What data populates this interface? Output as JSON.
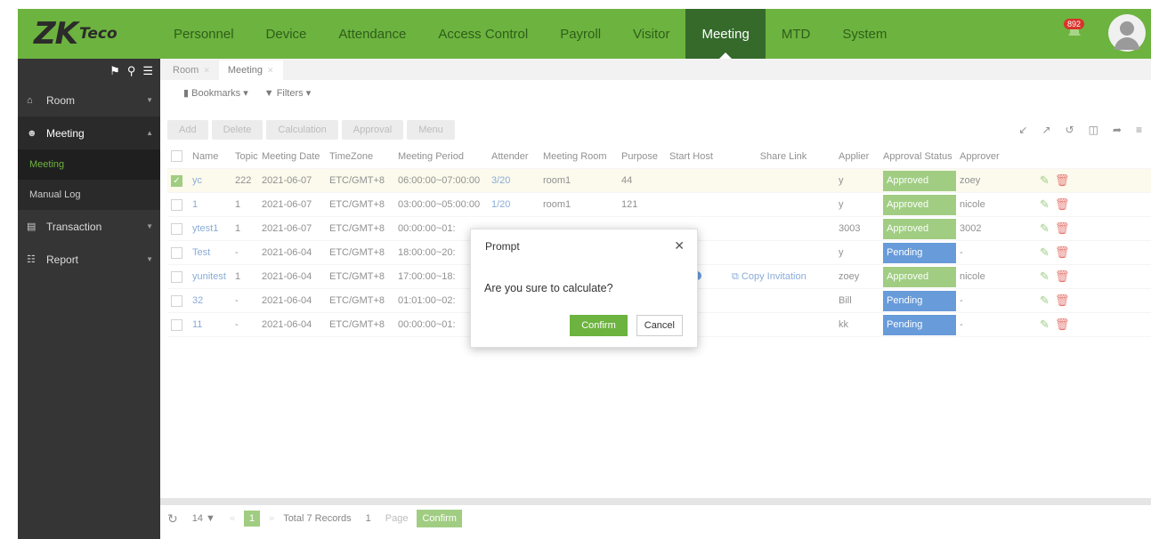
{
  "brand": {
    "logo_main": "ZK",
    "logo_sub": "Teco"
  },
  "nav": [
    "Personnel",
    "Device",
    "Attendance",
    "Access Control",
    "Payroll",
    "Visitor",
    "Meeting",
    "MTD",
    "System"
  ],
  "nav_active": "Meeting",
  "notifications": {
    "count": "892"
  },
  "sidebar": {
    "items": [
      {
        "label": "Room",
        "icon": "house-icon"
      },
      {
        "label": "Meeting",
        "icon": "people-icon"
      },
      {
        "label": "Transaction",
        "icon": "database-icon"
      },
      {
        "label": "Report",
        "icon": "report-icon"
      }
    ],
    "sub_items": [
      "Meeting",
      "Manual Log"
    ]
  },
  "tabs": [
    "Room",
    "Meeting"
  ],
  "filters": {
    "bookmarks": "Bookmarks",
    "filters": "Filters"
  },
  "toolbar": {
    "add": "Add",
    "delete": "Delete",
    "calculation": "Calculation",
    "approval": "Approval",
    "menu": "Menu"
  },
  "table": {
    "headers": [
      "Name",
      "Topic",
      "Meeting Date",
      "TimeZone",
      "Meeting Period",
      "Attender",
      "Meeting Room",
      "Purpose",
      "Start Host",
      "Share Link",
      "Applier",
      "Approval Status",
      "Approver"
    ],
    "rows": [
      {
        "name": "yc",
        "topic": "222",
        "date": "2021-06-07",
        "tz": "ETC/GMT+8",
        "period": "06:00:00~07:00:00",
        "attender": "3/20",
        "room": "room1",
        "purpose": "44",
        "share": "",
        "applier": "y",
        "status": "Approved",
        "approver": "zoey"
      },
      {
        "name": "1",
        "topic": "1",
        "date": "2021-06-07",
        "tz": "ETC/GMT+8",
        "period": "03:00:00~05:00:00",
        "attender": "1/20",
        "room": "room1",
        "purpose": "121",
        "share": "",
        "applier": "y",
        "status": "Approved",
        "approver": "nicole"
      },
      {
        "name": "ytest1",
        "topic": "1",
        "date": "2021-06-07",
        "tz": "ETC/GMT+8",
        "period": "00:00:00~01:",
        "attender": "",
        "room": "",
        "purpose": "",
        "share": "",
        "applier": "3003",
        "status": "Approved",
        "approver": "3002"
      },
      {
        "name": "Test",
        "topic": "-",
        "date": "2021-06-04",
        "tz": "ETC/GMT+8",
        "period": "18:00:00~20:",
        "attender": "",
        "room": "",
        "purpose": "",
        "share": "",
        "applier": "y",
        "status": "Pending",
        "approver": "-"
      },
      {
        "name": "yunitest",
        "topic": "1",
        "date": "2021-06-04",
        "tz": "ETC/GMT+8",
        "period": "17:00:00~18:",
        "attender": "",
        "room": "",
        "purpose": "",
        "share": "Copy Invitation",
        "applier": "zoey",
        "status": "Approved",
        "approver": "nicole"
      },
      {
        "name": "32",
        "topic": "-",
        "date": "2021-06-04",
        "tz": "ETC/GMT+8",
        "period": "01:01:00~02:",
        "attender": "",
        "room": "",
        "purpose": "",
        "share": "",
        "applier": "Bill",
        "status": "Pending",
        "approver": "-"
      },
      {
        "name": "11",
        "topic": "-",
        "date": "2021-06-04",
        "tz": "ETC/GMT+8",
        "period": "00:00:00~01:",
        "attender": "",
        "room": "",
        "purpose": "",
        "share": "",
        "applier": "kk",
        "status": "Pending",
        "approver": "-"
      }
    ]
  },
  "pager": {
    "page_size": "14",
    "current": "1",
    "total": "Total 7 Records",
    "page_input": "1",
    "page_label": "Page",
    "confirm": "Confirm"
  },
  "modal": {
    "title": "Prompt",
    "message": "Are you sure to calculate?",
    "confirm": "Confirm",
    "cancel": "Cancel"
  },
  "colors": {
    "brand_green": "#6db33f",
    "nav_active": "#356a2b",
    "pending_blue": "#1766c5",
    "sidebar_bg": "#353535"
  }
}
